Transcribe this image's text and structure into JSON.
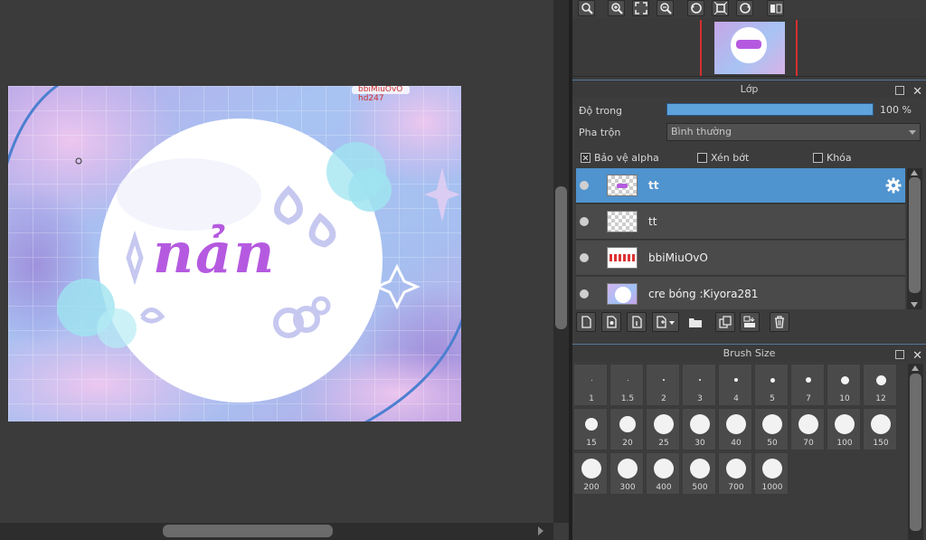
{
  "artwork": {
    "word": "nản",
    "watermark_line1": "bbiMiuOvO",
    "watermark_line2": "hd247"
  },
  "layer_panel": {
    "title": "Lớp",
    "opacity_label": "Độ trong",
    "opacity_value": "100 %",
    "opacity_fraction": 1.0,
    "blend_label": "Pha trộn",
    "blend_value": "Bình thường",
    "protect_alpha": "Bảo vệ alpha",
    "protect_alpha_checked": true,
    "clip": "Xén bớt",
    "clip_checked": false,
    "lock": "Khóa",
    "lock_checked": false,
    "layers": [
      {
        "name": "tt",
        "selected": true
      },
      {
        "name": "tt",
        "selected": false
      },
      {
        "name": "bbiMiuOvO",
        "selected": false
      },
      {
        "name": "cre bóng :Kiyora281",
        "selected": false
      }
    ]
  },
  "brush_panel": {
    "title": "Brush Size",
    "sizes": [
      "1",
      "1.5",
      "2",
      "3",
      "4",
      "5",
      "7",
      "10",
      "12",
      "15",
      "20",
      "25",
      "30",
      "40",
      "50",
      "70",
      "100",
      "150",
      "200",
      "300",
      "400",
      "500",
      "700",
      "1000"
    ]
  },
  "colors": {
    "selection": "#4f93cf",
    "accent_word": "#b55ae0",
    "nav_frame": "#d53030"
  }
}
